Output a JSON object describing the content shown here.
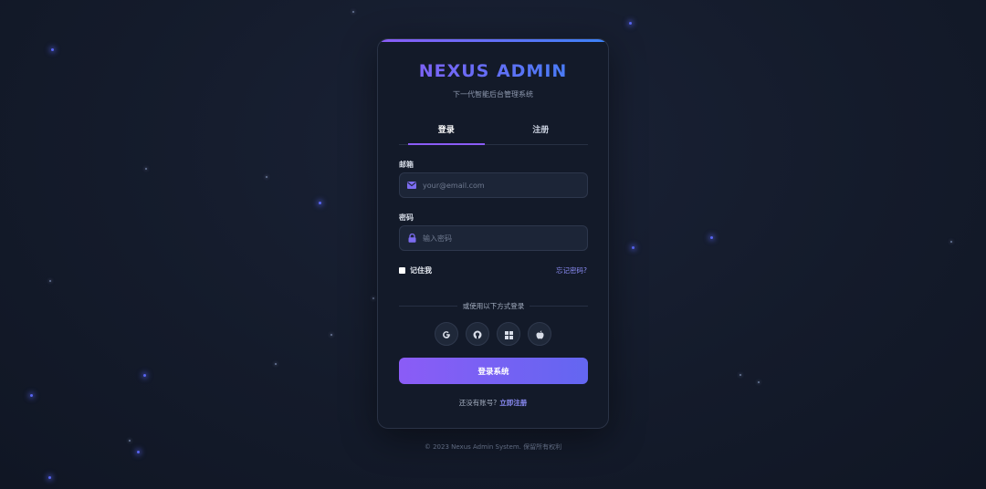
{
  "brand": {
    "title": "NEXUS ADMIN",
    "subtitle": "下一代智能后台管理系统"
  },
  "tabs": [
    {
      "label": "登录",
      "active": true
    },
    {
      "label": "注册",
      "active": false
    }
  ],
  "form": {
    "email_label": "邮箱",
    "email_placeholder": "your@email.com",
    "email_icon": "envelope-icon",
    "password_label": "密码",
    "password_placeholder": "输入密码",
    "password_icon": "lock-icon",
    "remember_label": "记住我",
    "remember_checked": false,
    "forgot_label": "忘记密码?"
  },
  "divider_text": "或使用以下方式登录",
  "social_logins": [
    {
      "name": "google-icon"
    },
    {
      "name": "github-icon"
    },
    {
      "name": "microsoft-icon"
    },
    {
      "name": "apple-icon"
    }
  ],
  "submit_label": "登录系统",
  "signup": {
    "prompt": "还没有账号?",
    "link": "立即注册"
  },
  "footer": "© 2023 Nexus Admin System. 保留所有权利",
  "colors": {
    "accent_start": "#8b5cf6",
    "accent_end": "#3b82f6",
    "button_end": "#6366f1",
    "link": "#8b8cf6",
    "background": "#141b2b",
    "card": "#131a29"
  }
}
